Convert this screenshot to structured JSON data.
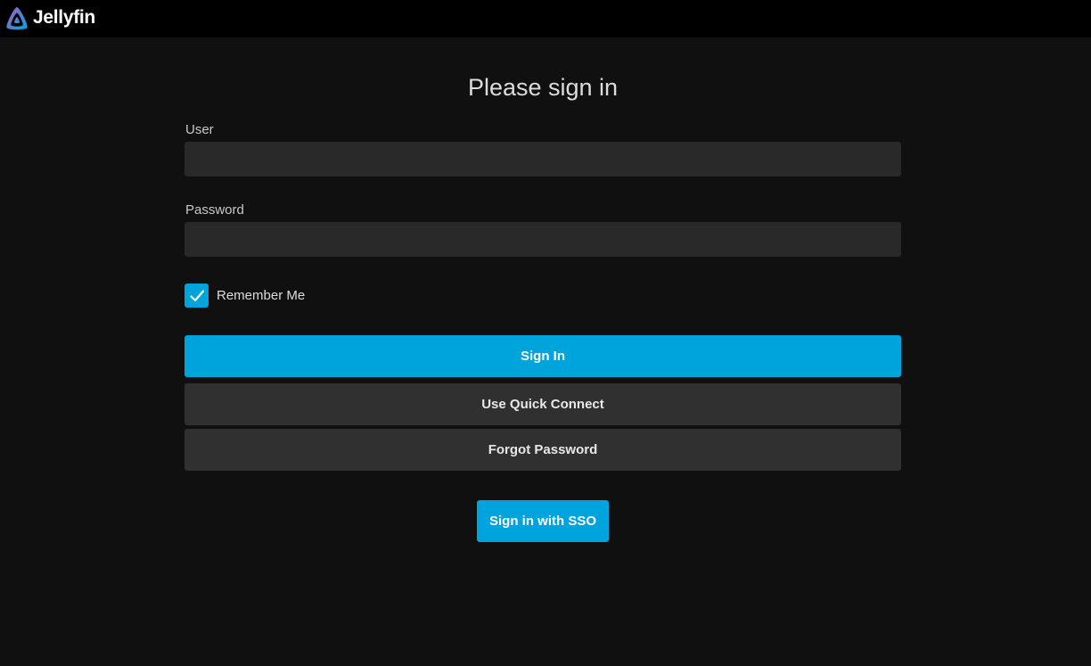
{
  "header": {
    "app_name": "Jellyfin",
    "logo_icon": "jellyfin-logo-icon"
  },
  "login": {
    "title": "Please sign in",
    "user_label": "User",
    "user_value": "",
    "password_label": "Password",
    "password_value": "",
    "remember_me_label": "Remember Me",
    "remember_me_checked": true,
    "sign_in_label": "Sign In",
    "quick_connect_label": "Use Quick Connect",
    "forgot_password_label": "Forgot Password",
    "sso_label": "Sign in with SSO"
  },
  "colors": {
    "accent": "#00a4dc",
    "background": "#101010",
    "header_background": "#000000",
    "input_background": "#292929",
    "secondary_button": "#303030"
  }
}
